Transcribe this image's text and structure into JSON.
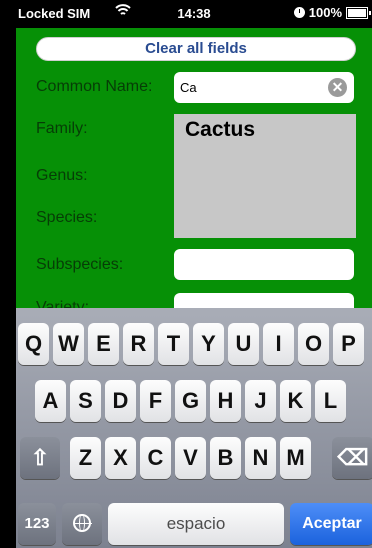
{
  "status_bar": {
    "carrier": "Locked SIM",
    "wifi_icon": "wifi-icon",
    "time": "14:38",
    "battery": "100%",
    "battery_level": 1.0
  },
  "form": {
    "clear_button": "Clear all fields",
    "fields": {
      "common_name": {
        "label": "Common Name:",
        "value": "Ca"
      },
      "family": {
        "label": "Family:"
      },
      "genus": {
        "label": "Genus:"
      },
      "species": {
        "label": "Species:"
      },
      "subspecies": {
        "label": "Subspecies:",
        "value": ""
      },
      "variety": {
        "label": "Variety:",
        "value": ""
      }
    },
    "suggestion": "Cactus"
  },
  "keyboard": {
    "row1": [
      "Q",
      "W",
      "E",
      "R",
      "T",
      "Y",
      "U",
      "I",
      "O",
      "P"
    ],
    "row2": [
      "A",
      "S",
      "D",
      "F",
      "G",
      "H",
      "J",
      "K",
      "L"
    ],
    "row3": [
      "Z",
      "X",
      "C",
      "V",
      "B",
      "N",
      "M"
    ],
    "numbers_key": "123",
    "space_key": "espacio",
    "accept_key": "Aceptar",
    "shift_glyph": "⇧",
    "delete_glyph": "⌫"
  }
}
